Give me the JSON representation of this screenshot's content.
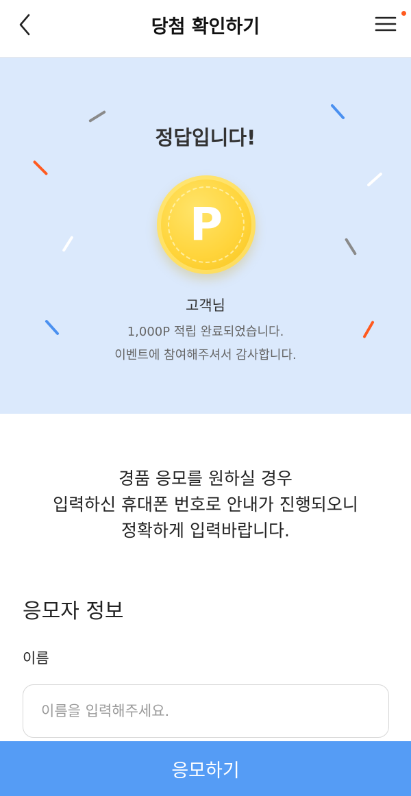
{
  "header": {
    "title": "당첨 확인하기",
    "back_icon": "chevron-left-icon",
    "menu_icon": "hamburger-menu-icon",
    "notification_color": "#ff5a1f"
  },
  "hero": {
    "background": "#dbe9fc",
    "title": "정답입니다!",
    "coin_letter": "P",
    "customer": "고객님",
    "message_line1": "1,000P 적립 완료되었습니다.",
    "message_line2": "이벤트에 참여해주셔서 감사합니다.",
    "confetti_colors": [
      "#ff5a1f",
      "#4a90f0",
      "#8a8a8a",
      "#ffffff"
    ]
  },
  "notice": {
    "line1": "경품 응모를 원하실 경우",
    "line2": "입력하신 휴대폰 번호로 안내가 진행되오니",
    "line3": "정확하게 입력바랍니다."
  },
  "form": {
    "section_title": "응모자 정보",
    "name_label": "이름",
    "name_placeholder": "이름을 입력해주세요.",
    "name_value": ""
  },
  "submit": {
    "label": "응모하기",
    "color": "#559cf5"
  }
}
